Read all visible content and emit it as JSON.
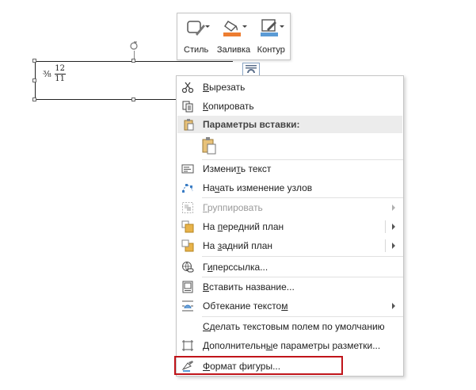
{
  "canvas": {
    "equation": {
      "prefix": "⅜",
      "numerator": "12",
      "denominator": "11"
    }
  },
  "mini_toolbar": {
    "buttons": [
      {
        "label": "Стиль",
        "icon": "shape-style-icon"
      },
      {
        "label": "Заливка",
        "icon": "paint-bucket-fill-icon",
        "accent": "#ed7d31"
      },
      {
        "label": "Контур",
        "icon": "pen-outline-icon",
        "accent": "#5b9bd5"
      }
    ]
  },
  "context_menu": {
    "items": [
      {
        "key": "cut",
        "label": "Вырезать",
        "underline": "В",
        "icon": "scissors-icon",
        "enabled": true
      },
      {
        "key": "copy",
        "label": "Копировать",
        "underline": "К",
        "icon": "copy-icon",
        "enabled": true
      },
      {
        "key": "paste_options",
        "label": "Параметры вставки:",
        "icon": "clipboard-icon",
        "header": true
      },
      {
        "key": "edit_text",
        "label": "Изменить текст",
        "underline": "т",
        "icon": "edit-text-icon",
        "enabled": true
      },
      {
        "key": "edit_points",
        "label": "Начать изменение узлов",
        "underline": "ч",
        "icon": "edit-points-icon",
        "enabled": true
      },
      {
        "key": "group",
        "label": "Группировать",
        "underline": "Г",
        "icon": "group-icon",
        "enabled": false,
        "submenu": true
      },
      {
        "key": "bring_front",
        "label": "На передний план",
        "underline": "п",
        "icon": "bring-to-front-icon",
        "enabled": true,
        "submenu": true
      },
      {
        "key": "send_back",
        "label": "На задний план",
        "underline": "з",
        "icon": "send-to-back-icon",
        "enabled": true,
        "submenu": true
      },
      {
        "key": "hyperlink",
        "label": "Гиперссылка...",
        "underline": "и",
        "icon": "hyperlink-icon",
        "enabled": true
      },
      {
        "key": "insert_caption",
        "label": "Вставить название...",
        "underline": "В",
        "icon": "insert-caption-icon",
        "enabled": true
      },
      {
        "key": "wrap_text",
        "label": "Обтекание текстом",
        "underline": "м",
        "icon": "wrap-text-icon",
        "enabled": true,
        "submenu": true
      },
      {
        "key": "set_default",
        "label": "Сделать текстовым полем по умолчанию",
        "underline": "С",
        "enabled": true
      },
      {
        "key": "more_layout",
        "label": "Дополнительные параметры разметки...",
        "underline": "ы",
        "icon": "layout-options-icon",
        "enabled": true
      },
      {
        "key": "format_shape",
        "label": "Формат фигуры...",
        "underline": "Ф",
        "icon": "format-shape-icon",
        "enabled": true,
        "highlighted": true
      }
    ]
  },
  "colors": {
    "highlight_border": "#c0141a",
    "menu_border": "#c6c6c6"
  }
}
